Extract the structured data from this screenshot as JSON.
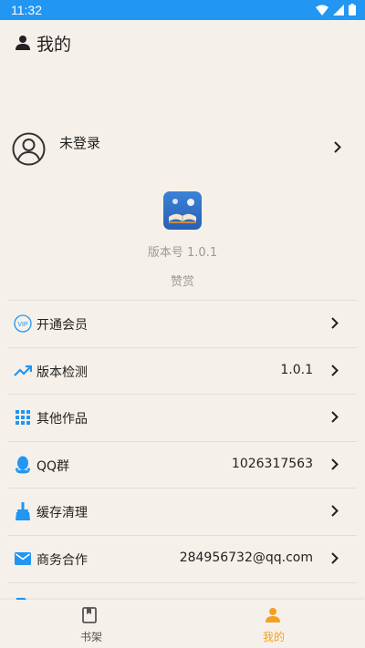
{
  "status_bar": {
    "time": "11:32"
  },
  "header": {
    "title": "我的"
  },
  "user": {
    "login_label": "未登录"
  },
  "about": {
    "version": "版本号 1.0.1",
    "reward": "赞赏"
  },
  "menu": {
    "items": [
      {
        "label": "开通会员",
        "value": "",
        "icon": "vip-icon"
      },
      {
        "label": "版本检测",
        "value": "1.0.1",
        "icon": "trending-up-icon"
      },
      {
        "label": "其他作品",
        "value": "",
        "icon": "grid-icon"
      },
      {
        "label": "QQ群",
        "value": "1026317563",
        "icon": "qq-icon"
      },
      {
        "label": "缓存清理",
        "value": "",
        "icon": "broom-icon"
      },
      {
        "label": "商务合作",
        "value": "284956732@qq.com",
        "icon": "mail-icon"
      }
    ]
  },
  "bottom_nav": {
    "tabs": [
      {
        "label": "书架",
        "active": false
      },
      {
        "label": "我的",
        "active": true
      }
    ]
  },
  "colors": {
    "status_bar": "#2196f3",
    "accent": "#2196f3",
    "active_tab": "#f5a020",
    "background": "#f5f1ea"
  }
}
